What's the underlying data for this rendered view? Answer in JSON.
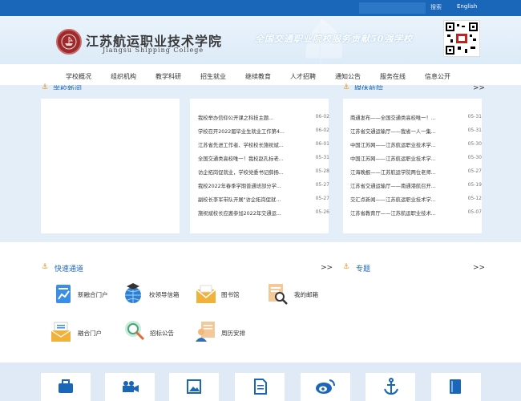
{
  "topbar": {
    "search_placeholder": "",
    "search_label": "搜索",
    "english": "English"
  },
  "header": {
    "logo_cn": "江苏航运职业技术学院",
    "logo_en": "Jiangsu Shipping College",
    "slogan": "全国交通职业院校服务贡献50强学校"
  },
  "nav": [
    "学校概况",
    "组织机构",
    "教学科研",
    "招生就业",
    "继续教育",
    "人才招聘",
    "通知公告",
    "服务在线",
    "信息公开"
  ],
  "school_news": {
    "title": "学校新闻",
    "items": [
      {
        "title": "我校举办信仰公开课之科技主题...",
        "date": "06-02"
      },
      {
        "title": "学校召开2022届毕业生就业工作第4...",
        "date": "06-02"
      },
      {
        "title": "江苏省先进工作者、学校校长施祝斌...",
        "date": "06-01"
      },
      {
        "title": "全国交通类高校唯一！我校赵孔标老...",
        "date": "05-31"
      },
      {
        "title": "访企拓岗促就业，学校党委书记薛扬...",
        "date": "05-28"
      },
      {
        "title": "我校2022年春季学期普通班部分学...",
        "date": "05-27"
      },
      {
        "title": "副校长李军带队开展\"访企拓岗促就...",
        "date": "05-27"
      },
      {
        "title": "施祝斌校长应邀参加2022年交通运...",
        "date": "05-26"
      }
    ]
  },
  "media": {
    "title": "媒体航院",
    "more": ">>",
    "items": [
      {
        "title": "南通发布——全国交通类高校唯一！...",
        "date": "05-31"
      },
      {
        "title": "江苏省交通运输厅——我省一人一集...",
        "date": "05-31"
      },
      {
        "title": "中国江苏网——江苏航运职业技术学...",
        "date": "05-30"
      },
      {
        "title": "中国江苏网——江苏航运职业技术学...",
        "date": "05-30"
      },
      {
        "title": "江海晚报——江苏航运学院两位老师...",
        "date": "05-27"
      },
      {
        "title": "江苏省交通运输厅——南通港航召开...",
        "date": "05-19"
      },
      {
        "title": "交汇点新闻——江苏航运职业技术学...",
        "date": "05-12"
      },
      {
        "title": "江苏省教育厅——江苏航运职业技术...",
        "date": "05-07"
      }
    ]
  },
  "quick": {
    "title": "快速通道",
    "more": ">>",
    "items": [
      {
        "label": "新融合门户",
        "icon": "chart-doc-icon"
      },
      {
        "label": "校领导信箱",
        "icon": "globe-graduation-icon"
      },
      {
        "label": "图书馆",
        "icon": "envelope-icon"
      },
      {
        "label": "我的邮箱",
        "icon": "magnifier-doc-icon"
      },
      {
        "label": "融合门户",
        "icon": "mail-doc-icon"
      },
      {
        "label": "招标公告",
        "icon": "magnifier-circle-icon"
      },
      {
        "label": "周历安排",
        "icon": "person-doc-icon"
      }
    ]
  },
  "topics": {
    "title": "专题",
    "more": ">>"
  },
  "bottom_icons": [
    "briefcase-icon",
    "video-camera-icon",
    "picture-icon",
    "document-icon",
    "weibo-icon",
    "anchor-icon",
    "book-icon"
  ],
  "colors": {
    "primary": "#1a66b8",
    "accent": "#e8931e",
    "band": "#e3eef9"
  }
}
